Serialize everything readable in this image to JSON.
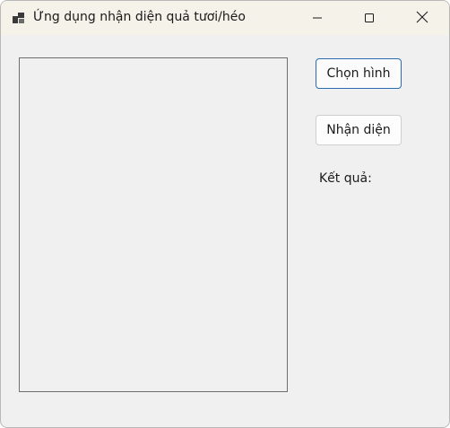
{
  "window": {
    "title": "Ứng dụng nhận diện quả tươi/héo",
    "app_icon": "windows-form-icon"
  },
  "titlebar_controls": {
    "minimize_icon": "minimize-icon",
    "maximize_icon": "maximize-icon",
    "close_icon": "close-icon"
  },
  "buttons": {
    "choose_image_label": "Chọn hình",
    "recognize_label": "Nhận diện"
  },
  "result": {
    "label": "Kết quả:"
  },
  "colors": {
    "titlebar_bg": "#f5f2ea",
    "window_bg": "#f0f0f0",
    "focus_border": "#2b6cb0"
  }
}
